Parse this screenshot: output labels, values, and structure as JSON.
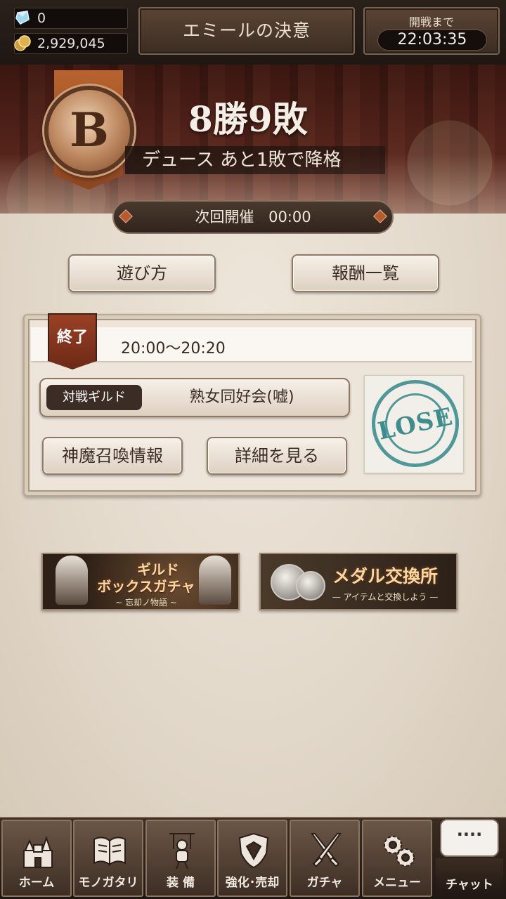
{
  "currency": {
    "gems": "0",
    "gold": "2,929,045"
  },
  "event": {
    "title": "エミールの決意"
  },
  "timer": {
    "label": "開戦まで",
    "value": "22:03:35"
  },
  "rank": {
    "letter": "B",
    "record": "8勝9敗",
    "status": "デュース あと1敗で降格"
  },
  "next_session": {
    "label": "次回開催",
    "time": "00:00"
  },
  "buttons": {
    "how_to_play": "遊び方",
    "rewards": "報酬一覧"
  },
  "match": {
    "tag": "終了",
    "time_range": "20:00〜20:20",
    "opponent_label": "対戦ギルド",
    "opponent_name": "熟女同好会(嘘)",
    "summon_info": "神魔召喚情報",
    "details": "詳細を見る",
    "result": "LOSE",
    "result_color": "#3d8d8d"
  },
  "promos": {
    "guild_box": {
      "title_line1": "ギルド",
      "title_line2": "ボックスガチャ",
      "subtitle": "~ 忘却ノ物語 ~"
    },
    "medal_exchange": {
      "title": "メダル交換所",
      "subtitle": "— アイテムと交換しよう —"
    }
  },
  "nav": [
    {
      "label": "ホーム",
      "icon": "castle-icon"
    },
    {
      "label": "モノガタリ",
      "icon": "book-icon"
    },
    {
      "label": "装 備",
      "icon": "puppet-icon"
    },
    {
      "label": "強化･売却",
      "icon": "shield-icon"
    },
    {
      "label": "ガチャ",
      "icon": "crossed-swords-icon"
    },
    {
      "label": "メニュー",
      "icon": "gears-icon"
    }
  ],
  "chat": {
    "bubble": "····",
    "label": "チャット"
  }
}
